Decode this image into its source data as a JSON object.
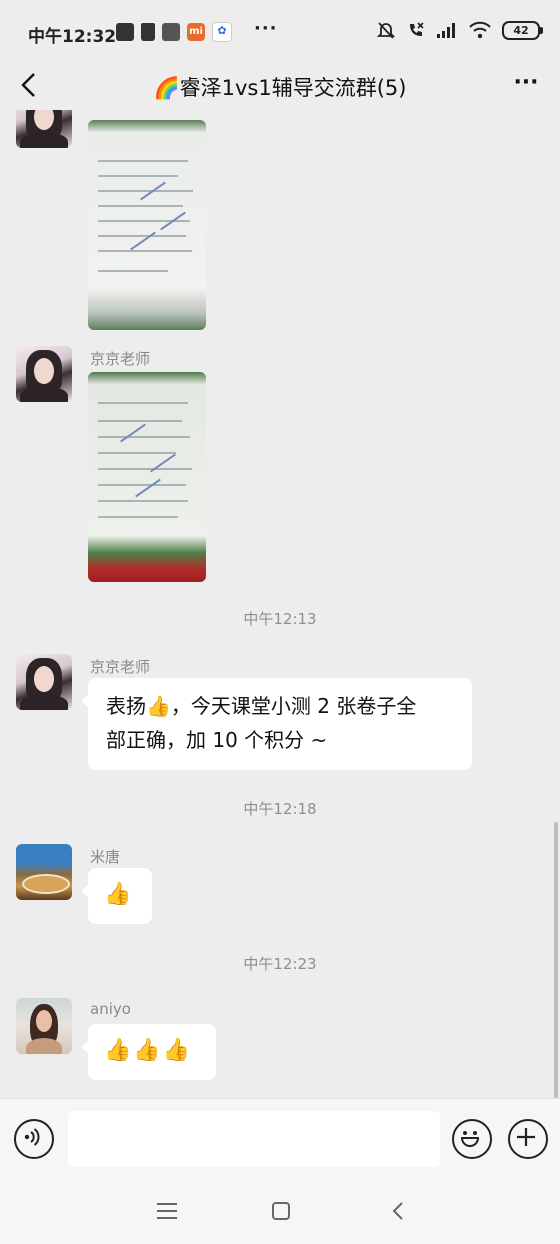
{
  "status_bar": {
    "time": "中午12:32",
    "more_dots": "···",
    "battery": "42"
  },
  "nav": {
    "title": "🌈睿泽1vs1辅导交流群(5)"
  },
  "messages": [
    {
      "type": "image",
      "sender": ""
    },
    {
      "type": "image",
      "sender": "京京老师"
    },
    {
      "type": "time",
      "text": "中午12:13"
    },
    {
      "type": "text",
      "sender": "京京老师",
      "line1": "表扬👍，今天课堂小测 2 张卷子全",
      "line2": "部正确，加 10 个积分 ~"
    },
    {
      "type": "time",
      "text": "中午12:18"
    },
    {
      "type": "text",
      "sender": "米唐",
      "text": "👍"
    },
    {
      "type": "time",
      "text": "中午12:23"
    },
    {
      "type": "text",
      "sender": "aniyo",
      "text": "👍👍👍"
    }
  ],
  "input": {
    "value": ""
  }
}
